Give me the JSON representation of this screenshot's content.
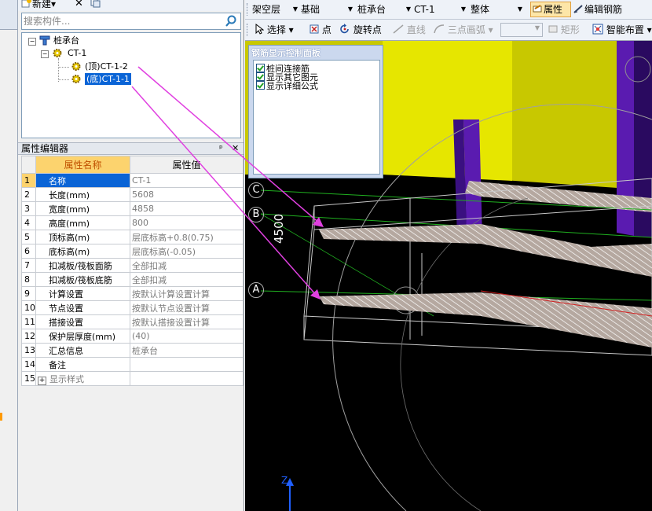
{
  "toolbar_left": {
    "new_label": "新建",
    "search_placeholder": "搜索构件..."
  },
  "tree": {
    "root": "桩承台",
    "child": "CT-1",
    "leaves": [
      "(顶)CT-1-2",
      "(底)CT-1-1"
    ]
  },
  "property_editor": {
    "title": "属性编辑器",
    "col_name": "属性名称",
    "col_value": "属性值",
    "rows": [
      {
        "n": "1",
        "name": "名称",
        "value": "CT-1"
      },
      {
        "n": "2",
        "name": "长度(mm)",
        "value": "5608"
      },
      {
        "n": "3",
        "name": "宽度(mm)",
        "value": "4858"
      },
      {
        "n": "4",
        "name": "高度(mm)",
        "value": "800"
      },
      {
        "n": "5",
        "name": "顶标高(m)",
        "value": "层底标高+0.8(0.75)"
      },
      {
        "n": "6",
        "name": "底标高(m)",
        "value": "层底标高(-0.05)"
      },
      {
        "n": "7",
        "name": "扣减板/筏板面筋",
        "value": "全部扣减"
      },
      {
        "n": "8",
        "name": "扣减板/筏板底筋",
        "value": "全部扣减"
      },
      {
        "n": "9",
        "name": "计算设置",
        "value": "按默认计算设置计算"
      },
      {
        "n": "10",
        "name": "节点设置",
        "value": "按默认节点设置计算"
      },
      {
        "n": "11",
        "name": "搭接设置",
        "value": "按默认搭接设置计算"
      },
      {
        "n": "12",
        "name": "保护层厚度(mm)",
        "value": "(40)"
      },
      {
        "n": "13",
        "name": "汇总信息",
        "value": "桩承台"
      },
      {
        "n": "14",
        "name": "备注",
        "value": ""
      },
      {
        "n": "15",
        "name": "显示样式",
        "value": ""
      }
    ]
  },
  "toolbar_right": {
    "floor": "架空层",
    "category": "基础",
    "type": "桩承台",
    "element": "CT-1",
    "scope": "整体",
    "properties_btn": "属性",
    "edit_rebar_btn": "编辑钢筋",
    "select_btn": "选择",
    "point_btn": "点",
    "rotate_point_btn": "旋转点",
    "line_btn": "直线",
    "arc_btn": "三点画弧",
    "rect_btn": "矩形",
    "smart_layout_btn": "智能布置"
  },
  "control_panel": {
    "title": "钢筋显示控制面板",
    "options": [
      "桩间连接筋",
      "显示其它图元",
      "显示详细公式"
    ]
  },
  "viewport": {
    "axis_labels": [
      "C",
      "B",
      "A"
    ],
    "dimension": "4500",
    "axis_z": "Z"
  },
  "colors": {
    "selection": "#0a64d6",
    "header_highlight": "#fcd36e",
    "arrow": "#e040e0",
    "yellow_wall": "#c8c800",
    "purple_column": "#5a1bb0",
    "rebar": "#b5a8a0"
  }
}
